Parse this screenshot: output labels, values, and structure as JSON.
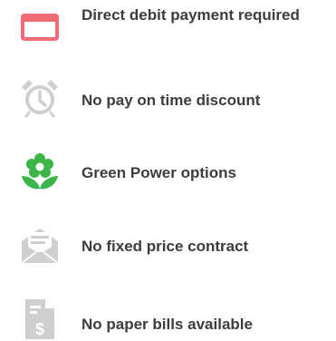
{
  "features": [
    {
      "label": "Direct debit payment required",
      "icon": "credit-card-icon",
      "color": "#f06b76"
    },
    {
      "label": "No pay on time discount",
      "icon": "alarm-clock-icon",
      "color": "#cfcfcf"
    },
    {
      "label": "Green Power options",
      "icon": "flower-icon",
      "color": "#3cb54a"
    },
    {
      "label": "No fixed price contract",
      "icon": "envelope-contract-icon",
      "color": "#cfcfcf"
    },
    {
      "label": "No paper bills available",
      "icon": "dollar-document-icon",
      "color": "#cfcfcf"
    }
  ]
}
